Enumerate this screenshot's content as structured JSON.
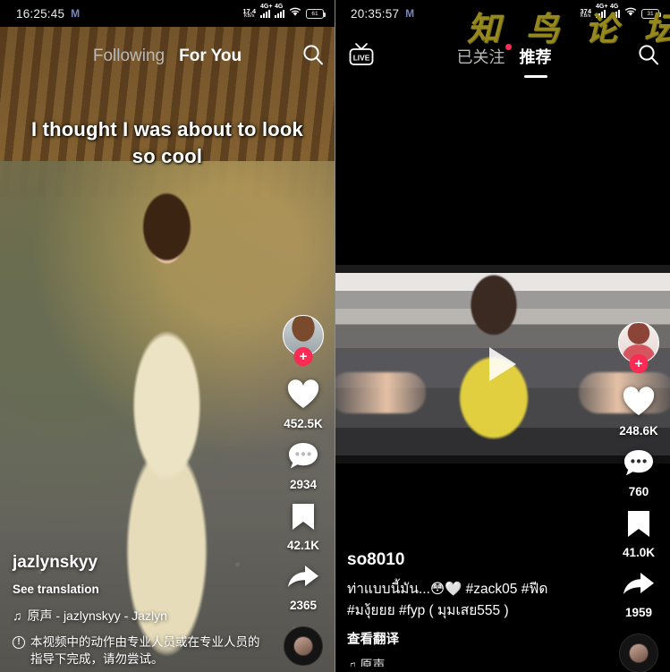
{
  "left_phone": {
    "status_bar": {
      "clock": "16:25:45",
      "carrier_badge": "M",
      "net_speed_value": "17.4",
      "net_speed_unit": "KB/s",
      "signal_1_label": "4G+",
      "signal_2_label": "4G",
      "wifi_icon": "wifi-icon",
      "battery_level": "61"
    },
    "top_nav": {
      "tab_following": "Following",
      "tab_foryou": "For You",
      "active_tab": "For You",
      "search_icon": "search-icon"
    },
    "video_caption": "I thought I was about to look\nso cool",
    "actions": {
      "avatar_name": "creator-avatar",
      "follow_label": "+",
      "like_icon": "heart-icon",
      "like_count": "452.5K",
      "comment_icon": "comment-icon",
      "comment_count": "2934",
      "bookmark_icon": "bookmark-icon",
      "bookmark_count": "42.1K",
      "share_icon": "share-arrow-icon",
      "share_count": "2365",
      "disc_icon": "music-disc-icon"
    },
    "info": {
      "username": "jazlynskyy",
      "see_translation": "See translation",
      "music_note_icon": "music-note-icon",
      "music_text": "原声 - jazlynskyy - Jazlyn",
      "warning_icon": "warning-icon",
      "warning_text": "本视频中的动作由专业人员或在专业人员的指导下完成，请勿尝试。"
    }
  },
  "right_phone": {
    "status_bar": {
      "clock": "20:35:57",
      "carrier_badge": "M",
      "net_speed_value": "374",
      "net_speed_unit": "KB/s",
      "signal_1_label": "4G+",
      "signal_2_label": "4G",
      "wifi_icon": "wifi-icon",
      "battery_level": "31"
    },
    "watermark": "知 鸟 论 坛",
    "watermark_color": "#94881f",
    "top_nav": {
      "live_label": "LIVE",
      "tab_following": "已关注",
      "tab_recommend": "推荐",
      "active_tab": "推荐",
      "has_following_badge": true,
      "search_icon": "search-icon"
    },
    "player": {
      "play_icon": "play-triangle-icon",
      "state": "paused"
    },
    "actions": {
      "avatar_name": "creator-avatar",
      "follow_label": "+",
      "like_icon": "heart-icon",
      "like_count": "248.6K",
      "comment_icon": "comment-icon",
      "comment_count": "760",
      "bookmark_icon": "bookmark-icon",
      "bookmark_count": "41.0K",
      "share_icon": "share-arrow-icon",
      "share_count": "1959",
      "disc_icon": "music-disc-icon"
    },
    "info": {
      "username": "so8010",
      "description_line1": "ท่าแบบนี้มัน...😳🤍 #zack05 #ฟีด",
      "description_line2": "#มงุ้ยยย #fyp ( มุมเสย555 )",
      "see_translation": "查看翻译"
    }
  },
  "theme": {
    "accent_red": "#fe2c55",
    "text_white": "#ffffff",
    "bg_black": "#000000"
  }
}
